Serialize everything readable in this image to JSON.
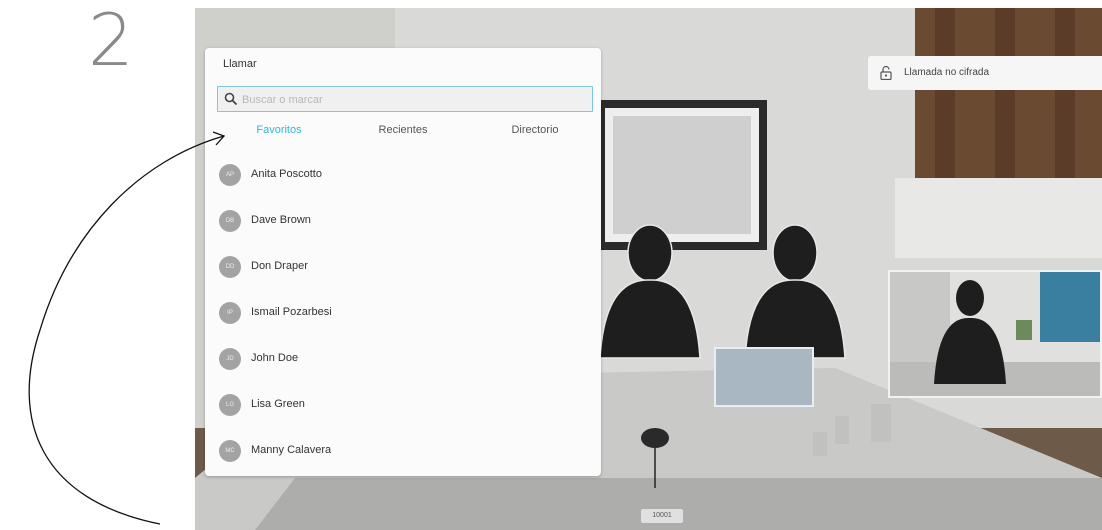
{
  "step": {
    "number": "2"
  },
  "call_panel": {
    "title": "Llamar",
    "search": {
      "placeholder": "Buscar o marcar",
      "value": ""
    },
    "tabs": [
      {
        "label": "Favoritos",
        "active": true
      },
      {
        "label": "Recientes",
        "active": false
      },
      {
        "label": "Directorio",
        "active": false
      }
    ],
    "contacts": [
      {
        "initials": "AP",
        "name": "Anita Poscotto"
      },
      {
        "initials": "DB",
        "name": "Dave Brown"
      },
      {
        "initials": "DD",
        "name": "Don Draper"
      },
      {
        "initials": "IP",
        "name": "Ismail Pozarbesi"
      },
      {
        "initials": "JD",
        "name": "John Doe"
      },
      {
        "initials": "LG",
        "name": "Lisa Green"
      },
      {
        "initials": "MC",
        "name": "Manny Calavera"
      }
    ]
  },
  "encryption_notice": {
    "text": "Llamada no cifrada",
    "icon": "unlock-icon"
  },
  "extension_label": "10001",
  "colors": {
    "accent": "#39b3d9",
    "avatar": "#a3a3a3"
  }
}
